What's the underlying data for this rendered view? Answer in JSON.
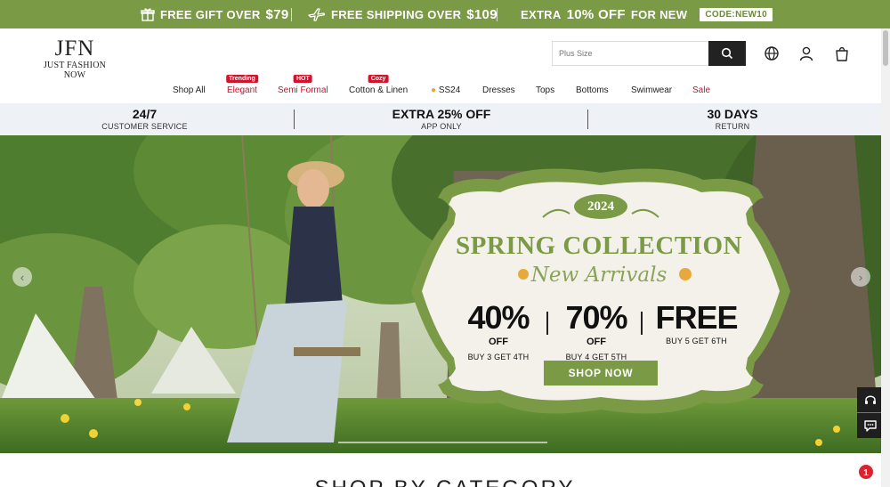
{
  "promo": {
    "items": [
      {
        "text": "FREE GIFT OVER",
        "amount": "$79",
        "icon": "gift-icon"
      },
      {
        "text": "FREE SHIPPING OVER",
        "amount": "$109",
        "icon": "airplane-icon"
      },
      {
        "text_pre": "EXTRA",
        "amount": "10% OFF",
        "text_post": "FOR NEW",
        "code": "CODE:NEW10"
      }
    ]
  },
  "header": {
    "logo_mark": "JFN",
    "logo_sub": "JUST FASHION NOW",
    "search_placeholder": "Plus Size",
    "icons": [
      "search-icon",
      "globe-icon",
      "user-icon",
      "bag-icon"
    ]
  },
  "nav": {
    "items": [
      {
        "label": "Shop All",
        "badge": ""
      },
      {
        "label": "Elegant",
        "badge": "Trending"
      },
      {
        "label": "Semi Formal",
        "badge": "HOT"
      },
      {
        "label": "Cotton & Linen",
        "badge": "Cozy"
      },
      {
        "label": "SS24",
        "badge": ""
      },
      {
        "label": "Dresses",
        "badge": ""
      },
      {
        "label": "Tops",
        "badge": ""
      },
      {
        "label": "Bottoms",
        "badge": ""
      },
      {
        "label": "Swimwear",
        "badge": ""
      },
      {
        "label": "Sale",
        "badge": ""
      }
    ]
  },
  "service": [
    {
      "title": "24/7",
      "sub": "CUSTOMER SERVICE"
    },
    {
      "title": "EXTRA 25% OFF",
      "sub": "APP ONLY"
    },
    {
      "title": "30 DAYS",
      "sub": "RETURN"
    }
  ],
  "hero": {
    "year": "2024",
    "title": "SPRING COLLECTION",
    "subtitle": "New Arrivals",
    "offers": [
      {
        "pct": "40%",
        "off": "OFF",
        "sub": "BUY 3 GET 4TH"
      },
      {
        "pct": "70%",
        "off": "OFF",
        "sub": "BUY 4 GET 5TH"
      },
      {
        "pct": "FREE",
        "off": "",
        "sub": "BUY 5 GET 6TH"
      }
    ],
    "cta": "SHOP NOW",
    "colors": {
      "accent": "#7a9a46",
      "frame": "#f3f1ea"
    }
  },
  "section": {
    "title": "SHOP BY CATEGORY"
  },
  "notification_count": "1"
}
